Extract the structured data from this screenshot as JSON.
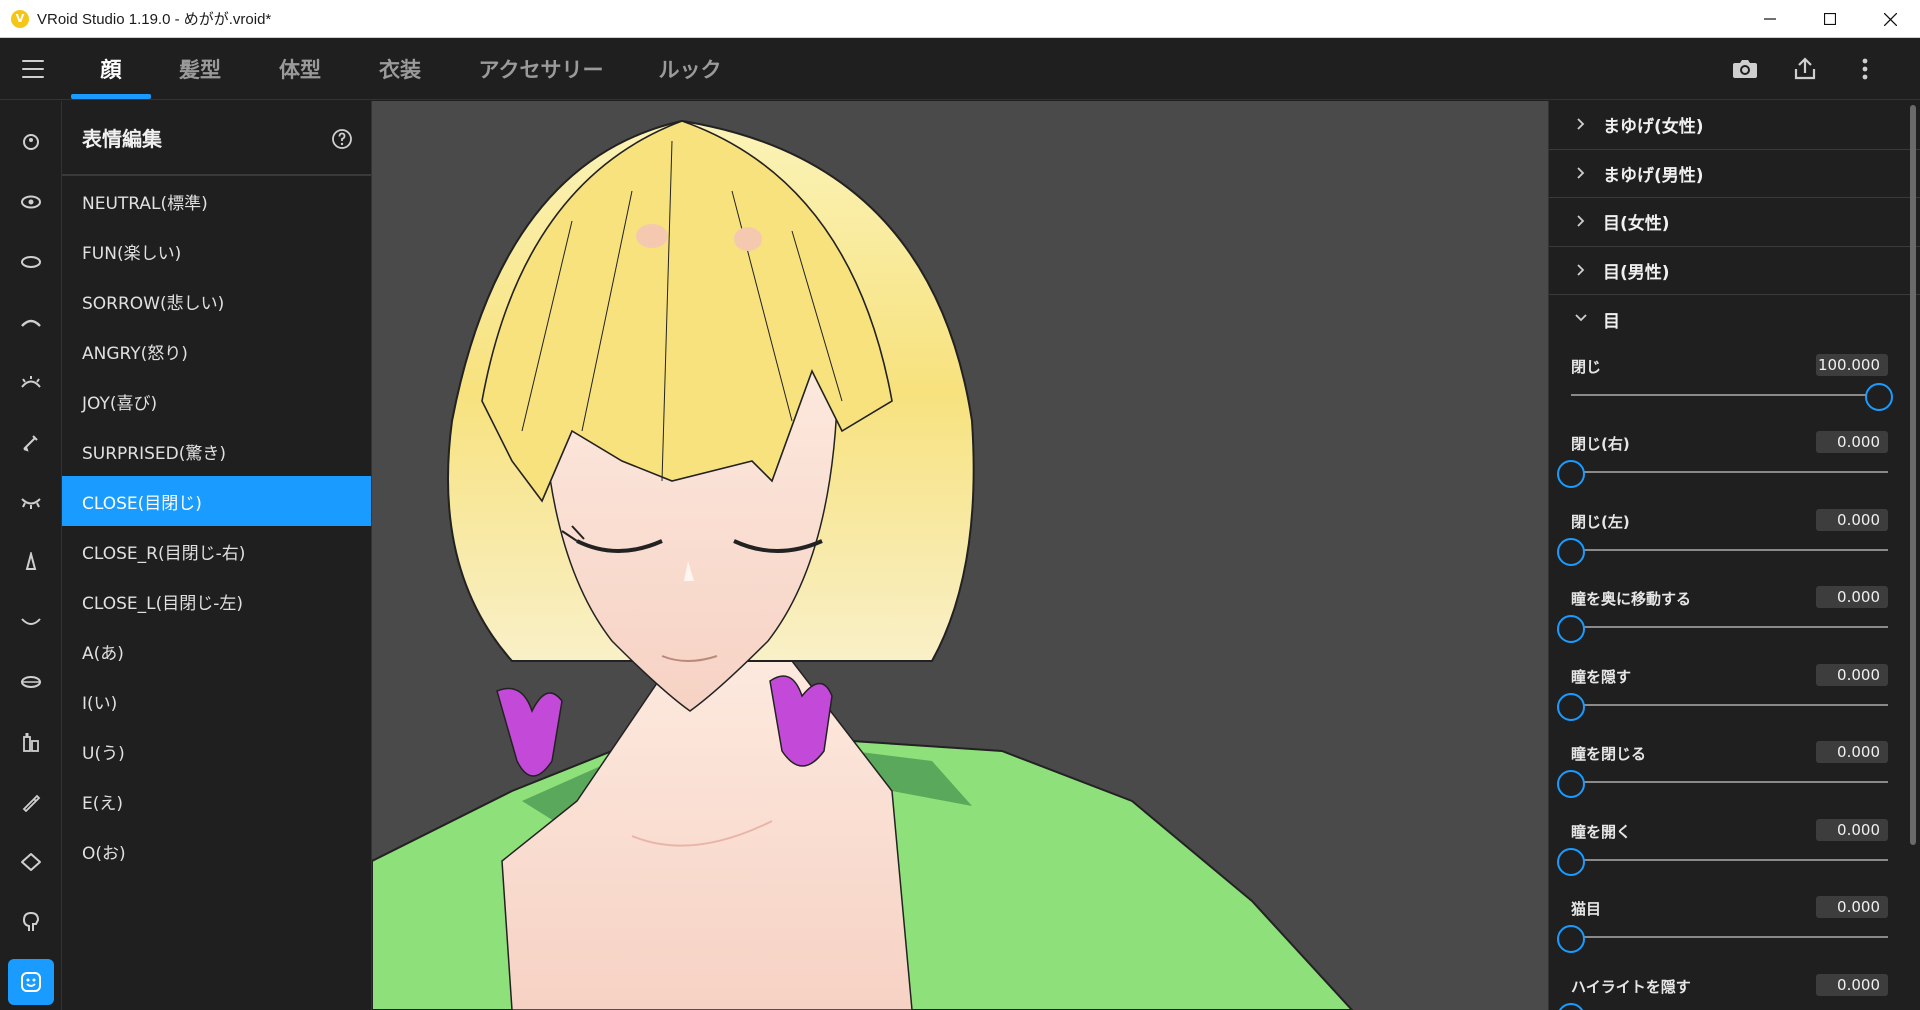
{
  "window": {
    "title": "VRoid Studio 1.19.0 - めがが.vroid*"
  },
  "nav": {
    "tabs": [
      {
        "label": "顔",
        "active": true
      },
      {
        "label": "髪型",
        "active": false
      },
      {
        "label": "体型",
        "active": false
      },
      {
        "label": "衣装",
        "active": false
      },
      {
        "label": "アクセサリー",
        "active": false
      },
      {
        "label": "ルック",
        "active": false
      }
    ],
    "actions": [
      "camera-icon",
      "export-icon",
      "more-vertical-icon"
    ]
  },
  "rail": {
    "items": [
      "face-preset-icon",
      "eye-icon",
      "eye-outline-icon",
      "eyebrow-icon",
      "eyelash-icon",
      "brush-icon",
      "closed-eye-icon",
      "nose-icon",
      "mouth-icon",
      "lips-icon",
      "bottles-icon",
      "pen-icon",
      "head-shape-icon",
      "head-profile-icon",
      "expression-face-icon"
    ],
    "active_index": 14
  },
  "expressions": {
    "title": "表情編集",
    "items": [
      "NEUTRAL(標準)",
      "FUN(楽しい)",
      "SORROW(悲しい)",
      "ANGRY(怒り)",
      "JOY(喜び)",
      "SURPRISED(驚き)",
      "CLOSE(目閉じ)",
      "CLOSE_R(目閉じ-右)",
      "CLOSE_L(目閉じ-左)",
      "A(あ)",
      "I(い)",
      "U(う)",
      "E(え)",
      "O(お)"
    ],
    "selected_index": 6
  },
  "props": {
    "sections": [
      {
        "label": "まゆげ(女性)"
      },
      {
        "label": "まゆげ(男性)"
      },
      {
        "label": "目(女性)"
      },
      {
        "label": "目(男性)"
      }
    ],
    "open_section": {
      "label": "目"
    },
    "sliders": [
      {
        "label": "閉じ",
        "value": "100.000",
        "fraction": 1.0
      },
      {
        "label": "閉じ(右)",
        "value": "0.000",
        "fraction": 0
      },
      {
        "label": "閉じ(左)",
        "value": "0.000",
        "fraction": 0
      },
      {
        "label": "瞳を奥に移動する",
        "value": "0.000",
        "fraction": 0
      },
      {
        "label": "瞳を隠す",
        "value": "0.000",
        "fraction": 0
      },
      {
        "label": "瞳を閉じる",
        "value": "0.000",
        "fraction": 0
      },
      {
        "label": "瞳を開く",
        "value": "0.000",
        "fraction": 0
      },
      {
        "label": "猫目",
        "value": "0.000",
        "fraction": 0
      },
      {
        "label": "ハイライトを隠す",
        "value": "0.000",
        "fraction": 0
      }
    ]
  },
  "colors": {
    "accent": "#1a9bff",
    "hair": "#f7e58a",
    "clothing": "#8ee07a",
    "bow": "#c34ad8",
    "background_viewport": "#4a4a4a"
  }
}
